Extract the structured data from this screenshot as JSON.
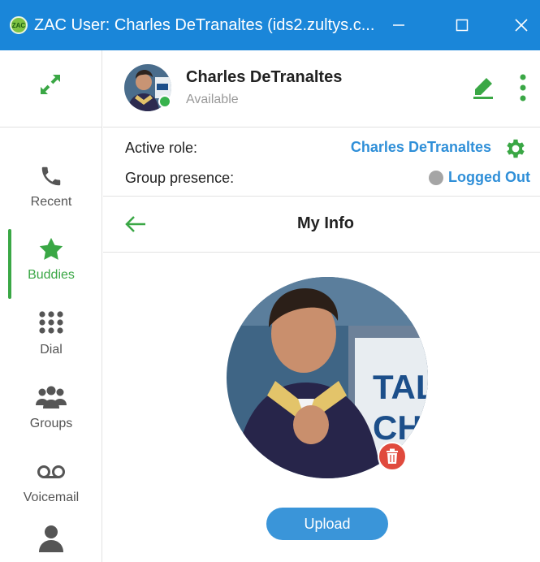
{
  "window": {
    "app_icon_text": "ZAC",
    "title": "ZAC User: Charles DeTranaltes (ids2.zultys.c..."
  },
  "sidebar": {
    "items": [
      {
        "label": "Recent",
        "icon": "phone-icon"
      },
      {
        "label": "Buddies",
        "icon": "star-icon",
        "active": true
      },
      {
        "label": "Dial",
        "icon": "dialpad-icon"
      },
      {
        "label": "Groups",
        "icon": "group-icon"
      },
      {
        "label": "Voicemail",
        "icon": "voicemail-icon"
      },
      {
        "label": "",
        "icon": "person-icon"
      }
    ]
  },
  "header": {
    "user_name": "Charles DeTranaltes",
    "status": "Available"
  },
  "roles": {
    "active_role_label": "Active role:",
    "active_role_value": "Charles DeTranaltes",
    "group_presence_label": "Group presence:",
    "group_presence_value": "Logged Out"
  },
  "page": {
    "title": "My Info",
    "upload_label": "Upload"
  },
  "colors": {
    "titlebar": "#1a86d9",
    "accent_green": "#3aa745",
    "link_blue": "#2f8fd8",
    "upload_button": "#3a95d9",
    "delete_red": "#e04a3d",
    "presence_gray": "#a5a5a5"
  }
}
